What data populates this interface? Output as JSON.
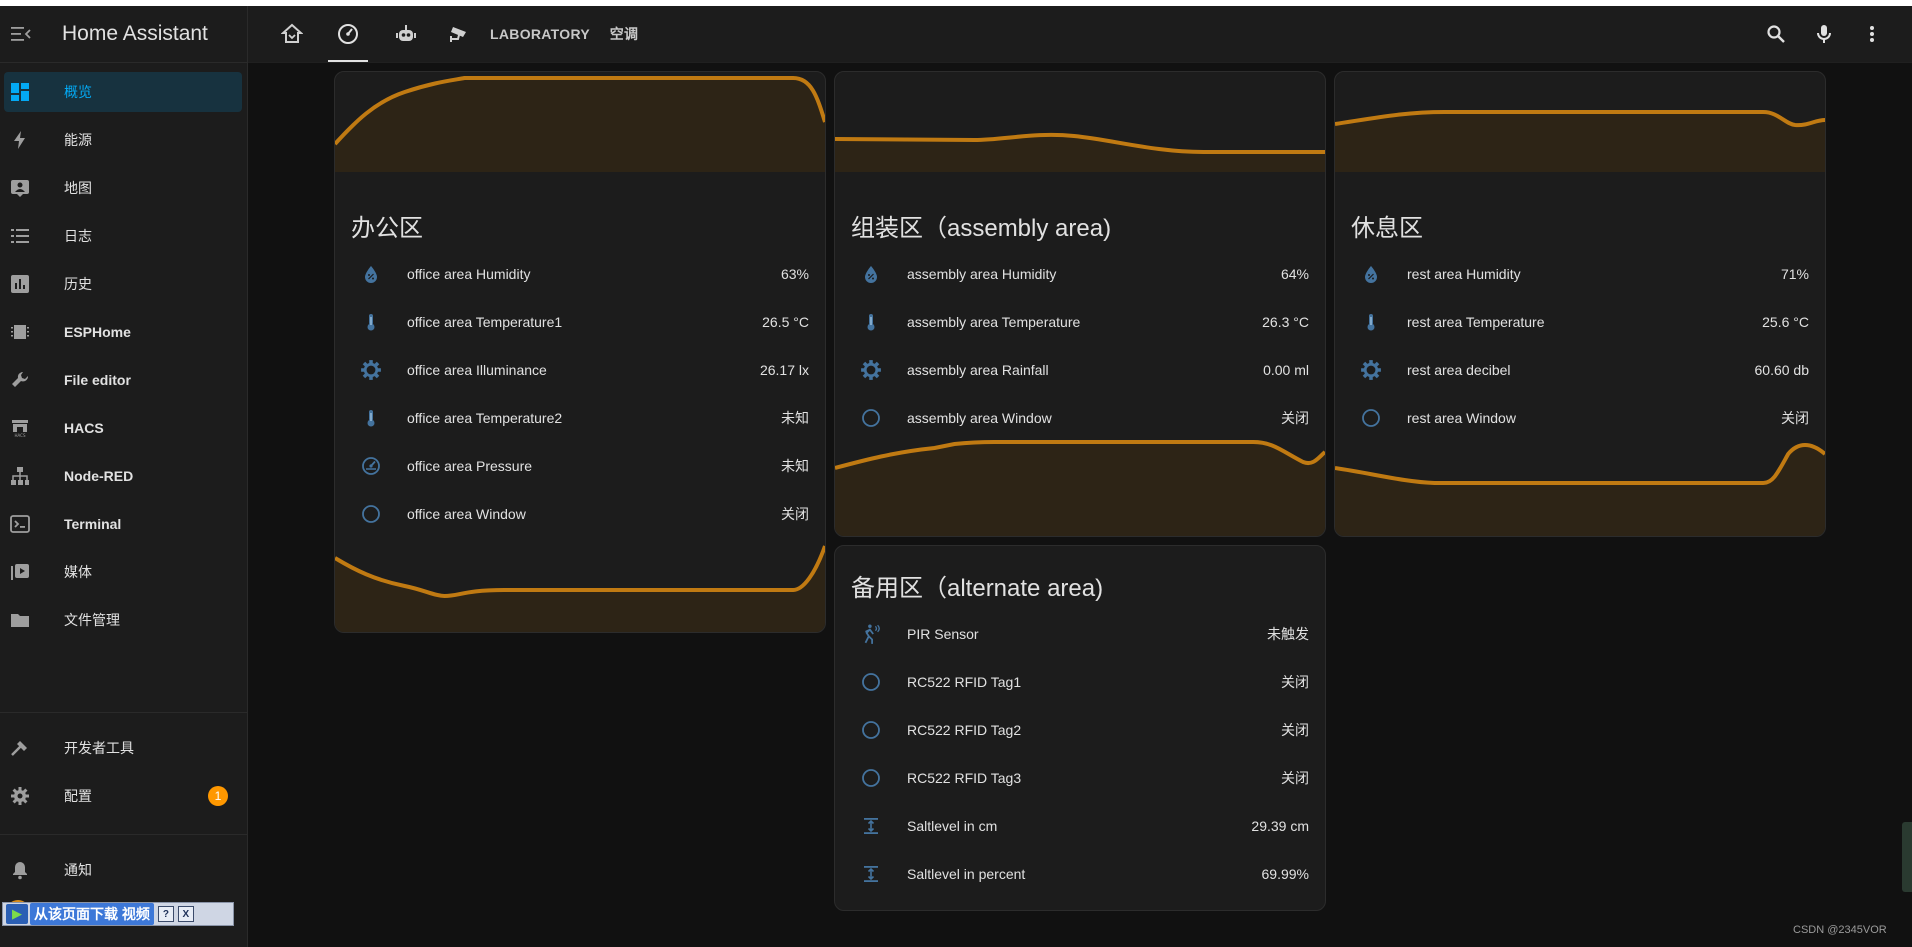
{
  "app": {
    "title": "Home Assistant"
  },
  "sidebar": {
    "items": [
      {
        "label": "概览",
        "icon": "dashboard-icon",
        "active": true
      },
      {
        "label": "能源",
        "icon": "lightning-icon"
      },
      {
        "label": "地图",
        "icon": "map-account-icon"
      },
      {
        "label": "日志",
        "icon": "logbook-icon"
      },
      {
        "label": "历史",
        "icon": "chart-box-icon"
      },
      {
        "label": "ESPHome",
        "icon": "chip-icon"
      },
      {
        "label": "File editor",
        "icon": "wrench-icon"
      },
      {
        "label": "HACS",
        "icon": "hacs-icon"
      },
      {
        "label": "Node-RED",
        "icon": "sitemap-icon"
      },
      {
        "label": "Terminal",
        "icon": "console-icon"
      },
      {
        "label": "媒体",
        "icon": "media-icon"
      },
      {
        "label": "文件管理",
        "icon": "folder-icon"
      }
    ],
    "developer_tools": "开发者工具",
    "settings": "配置",
    "settings_badge": "1",
    "notifications": "通知"
  },
  "download_bar": {
    "text": "从该页面下载 视频",
    "help": "?",
    "close": "X"
  },
  "topbar": {
    "tabs": [
      {
        "icon": "home-icon"
      },
      {
        "icon": "gauge-icon",
        "active": true
      },
      {
        "icon": "robot-icon"
      },
      {
        "icon": "cctv-icon"
      },
      {
        "label": "LABORATORY"
      },
      {
        "label": "空调"
      }
    ],
    "actions": [
      "search-icon",
      "microphone-icon",
      "more-vert-icon"
    ]
  },
  "cards": {
    "office": {
      "title": "办公区",
      "rows": [
        {
          "icon": "water-percent-icon",
          "name": "office area Humidity",
          "value": "63%"
        },
        {
          "icon": "thermometer-icon",
          "name": "office area Temperature1",
          "value": "26.5 °C"
        },
        {
          "icon": "sun-gear-icon",
          "name": "office area Illuminance",
          "value": "26.17 lx"
        },
        {
          "icon": "thermometer-icon",
          "name": "office area Temperature2",
          "value": "未知"
        },
        {
          "icon": "gauge-icon",
          "name": "office area Pressure",
          "value": "未知"
        },
        {
          "icon": "circle-outline-icon",
          "name": "office area Window",
          "value": "关闭"
        }
      ]
    },
    "assembly": {
      "title": "组装区（assembly area)",
      "rows": [
        {
          "icon": "water-percent-icon",
          "name": "assembly area Humidity",
          "value": "64%"
        },
        {
          "icon": "thermometer-icon",
          "name": "assembly area Temperature",
          "value": "26.3 °C"
        },
        {
          "icon": "sun-gear-icon",
          "name": "assembly area Rainfall",
          "value": "0.00 ml"
        },
        {
          "icon": "circle-outline-icon",
          "name": "assembly area Window",
          "value": "关闭"
        }
      ]
    },
    "rest": {
      "title": "休息区",
      "rows": [
        {
          "icon": "water-percent-icon",
          "name": "rest area Humidity",
          "value": "71%"
        },
        {
          "icon": "thermometer-icon",
          "name": "rest area Temperature",
          "value": "25.6 °C"
        },
        {
          "icon": "sun-gear-icon",
          "name": "rest area decibel",
          "value": "60.60 db"
        },
        {
          "icon": "circle-outline-icon",
          "name": "rest area Window",
          "value": "关闭"
        }
      ]
    },
    "alternate": {
      "title": "备用区（alternate area)",
      "rows": [
        {
          "icon": "motion-sensor-icon",
          "name": "PIR Sensor",
          "value": "未触发"
        },
        {
          "icon": "circle-outline-icon",
          "name": "RC522 RFID Tag1",
          "value": "关闭"
        },
        {
          "icon": "circle-outline-icon",
          "name": "RC522 RFID Tag2",
          "value": "关闭"
        },
        {
          "icon": "circle-outline-icon",
          "name": "RC522 RFID Tag3",
          "value": "关闭"
        },
        {
          "icon": "arrow-expand-vertical-icon",
          "name": "Saltlevel in cm",
          "value": "29.39 cm"
        },
        {
          "icon": "arrow-expand-vertical-icon",
          "name": "Saltlevel in percent",
          "value": "69.99%"
        }
      ]
    }
  },
  "footer": {
    "watermark": "CSDN @2345VOR"
  },
  "colors": {
    "accent": "#03a9f4",
    "graph": "#c07a12",
    "icon": "#44739e",
    "badge": "#ff9800"
  }
}
